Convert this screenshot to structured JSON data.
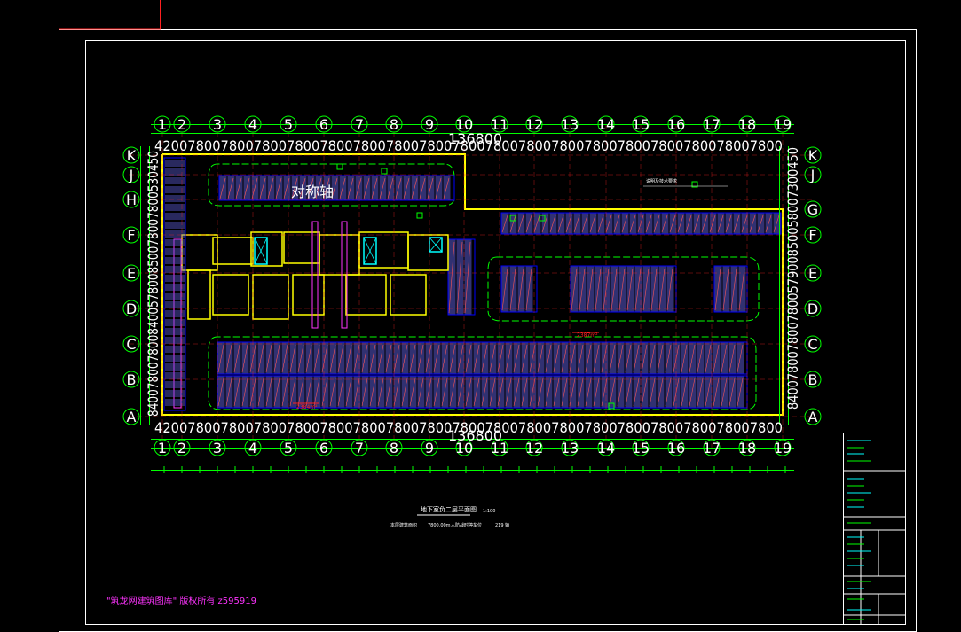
{
  "drawing": {
    "grid_numbers": [
      "1",
      "2",
      "3",
      "4",
      "5",
      "6",
      "7",
      "8",
      "9",
      "10",
      "11",
      "12",
      "13",
      "14",
      "15",
      "16",
      "17",
      "18",
      "19"
    ],
    "grid_letters_left": [
      "K",
      "J",
      "H",
      "F",
      "E",
      "D",
      "C",
      "B",
      "A"
    ],
    "grid_letters_right": [
      "K",
      "J",
      "G",
      "F",
      "E",
      "D",
      "C",
      "B",
      "A"
    ],
    "top_dims": "4200780078007800780078007800780078007800780078007800780078007800780078007800",
    "total_dim": "136800",
    "bottom_dims": "4200780078007800780078007800780078007800780078007800780078007800780078007800",
    "left_dims": "840078007800840057800850078007800530450",
    "right_dims": "840078007800780057900850058007300450",
    "axis_label": "对称轴",
    "red_area_left": "2384m²",
    "red_area_right": "2387m²",
    "notes_label": "说明及技术要求",
    "title": "地下室负二层平面图",
    "title_scale": "1:100",
    "info_line_1": "本层建筑面积",
    "info_line_1_value": "7800.00m",
    "info_line_2": "人防战时停车位",
    "info_line_2_value": "219 辆",
    "watermark": "\"筑龙网建筑图库\" 版权所有 z595919"
  },
  "colors": {
    "background": "#000000",
    "grid_green": "#00ff00",
    "structure_yellow": "#ffff00",
    "parking_blue": "#5a5ad0",
    "parking_frame": "#0000ff",
    "lines_red": "#ff2020",
    "accent_magenta": "#ff33ff",
    "cyan": "#00ffff",
    "white": "#ffffff"
  }
}
